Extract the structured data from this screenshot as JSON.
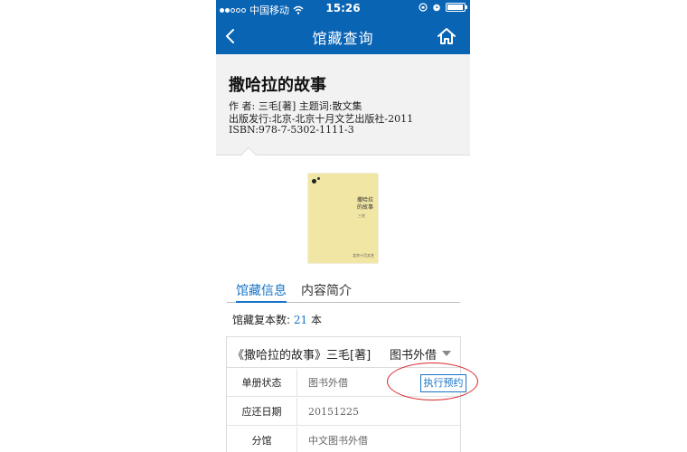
{
  "status_bar": {
    "carrier": "中国移动",
    "time": "15:26",
    "wifi_icon": "wifi-icon",
    "lock_icon": "rotation-lock-icon",
    "alarm_icon": "alarm-icon",
    "battery_icon": "battery-icon"
  },
  "nav": {
    "title": "馆藏查询",
    "back_icon": "chevron-left-icon",
    "home_icon": "home-icon"
  },
  "book": {
    "title": "撒哈拉的故事",
    "author_line": "作 者: 三毛[著]  主题词:散文集",
    "publish_line": "出版发行:北京-北京十月文艺出版社-2011",
    "isbn_line": "ISBN:978-7-5302-1111-3",
    "cover": {
      "title": "撒哈拉的故事",
      "author": "三毛",
      "publisher": "北京十月文艺"
    }
  },
  "tabs": [
    {
      "label": "馆藏信息",
      "active": true
    },
    {
      "label": "内容简介",
      "active": false
    }
  ],
  "copies": {
    "label": "馆藏复本数:",
    "count": "21",
    "unit": "本"
  },
  "holding": {
    "title": "《撒哈拉的故事》三毛[著]",
    "type": "图书外借",
    "rows": [
      {
        "label": "单册状态",
        "value": "图书外借"
      },
      {
        "label": "应还日期",
        "value": "20151225"
      },
      {
        "label": "分馆",
        "value": "中文图书外借"
      }
    ],
    "reserve_button": "执行预约"
  },
  "colors": {
    "nav_blue": "#0a64b4",
    "accent": "#1874c8",
    "highlight_ring": "#d9262b"
  }
}
